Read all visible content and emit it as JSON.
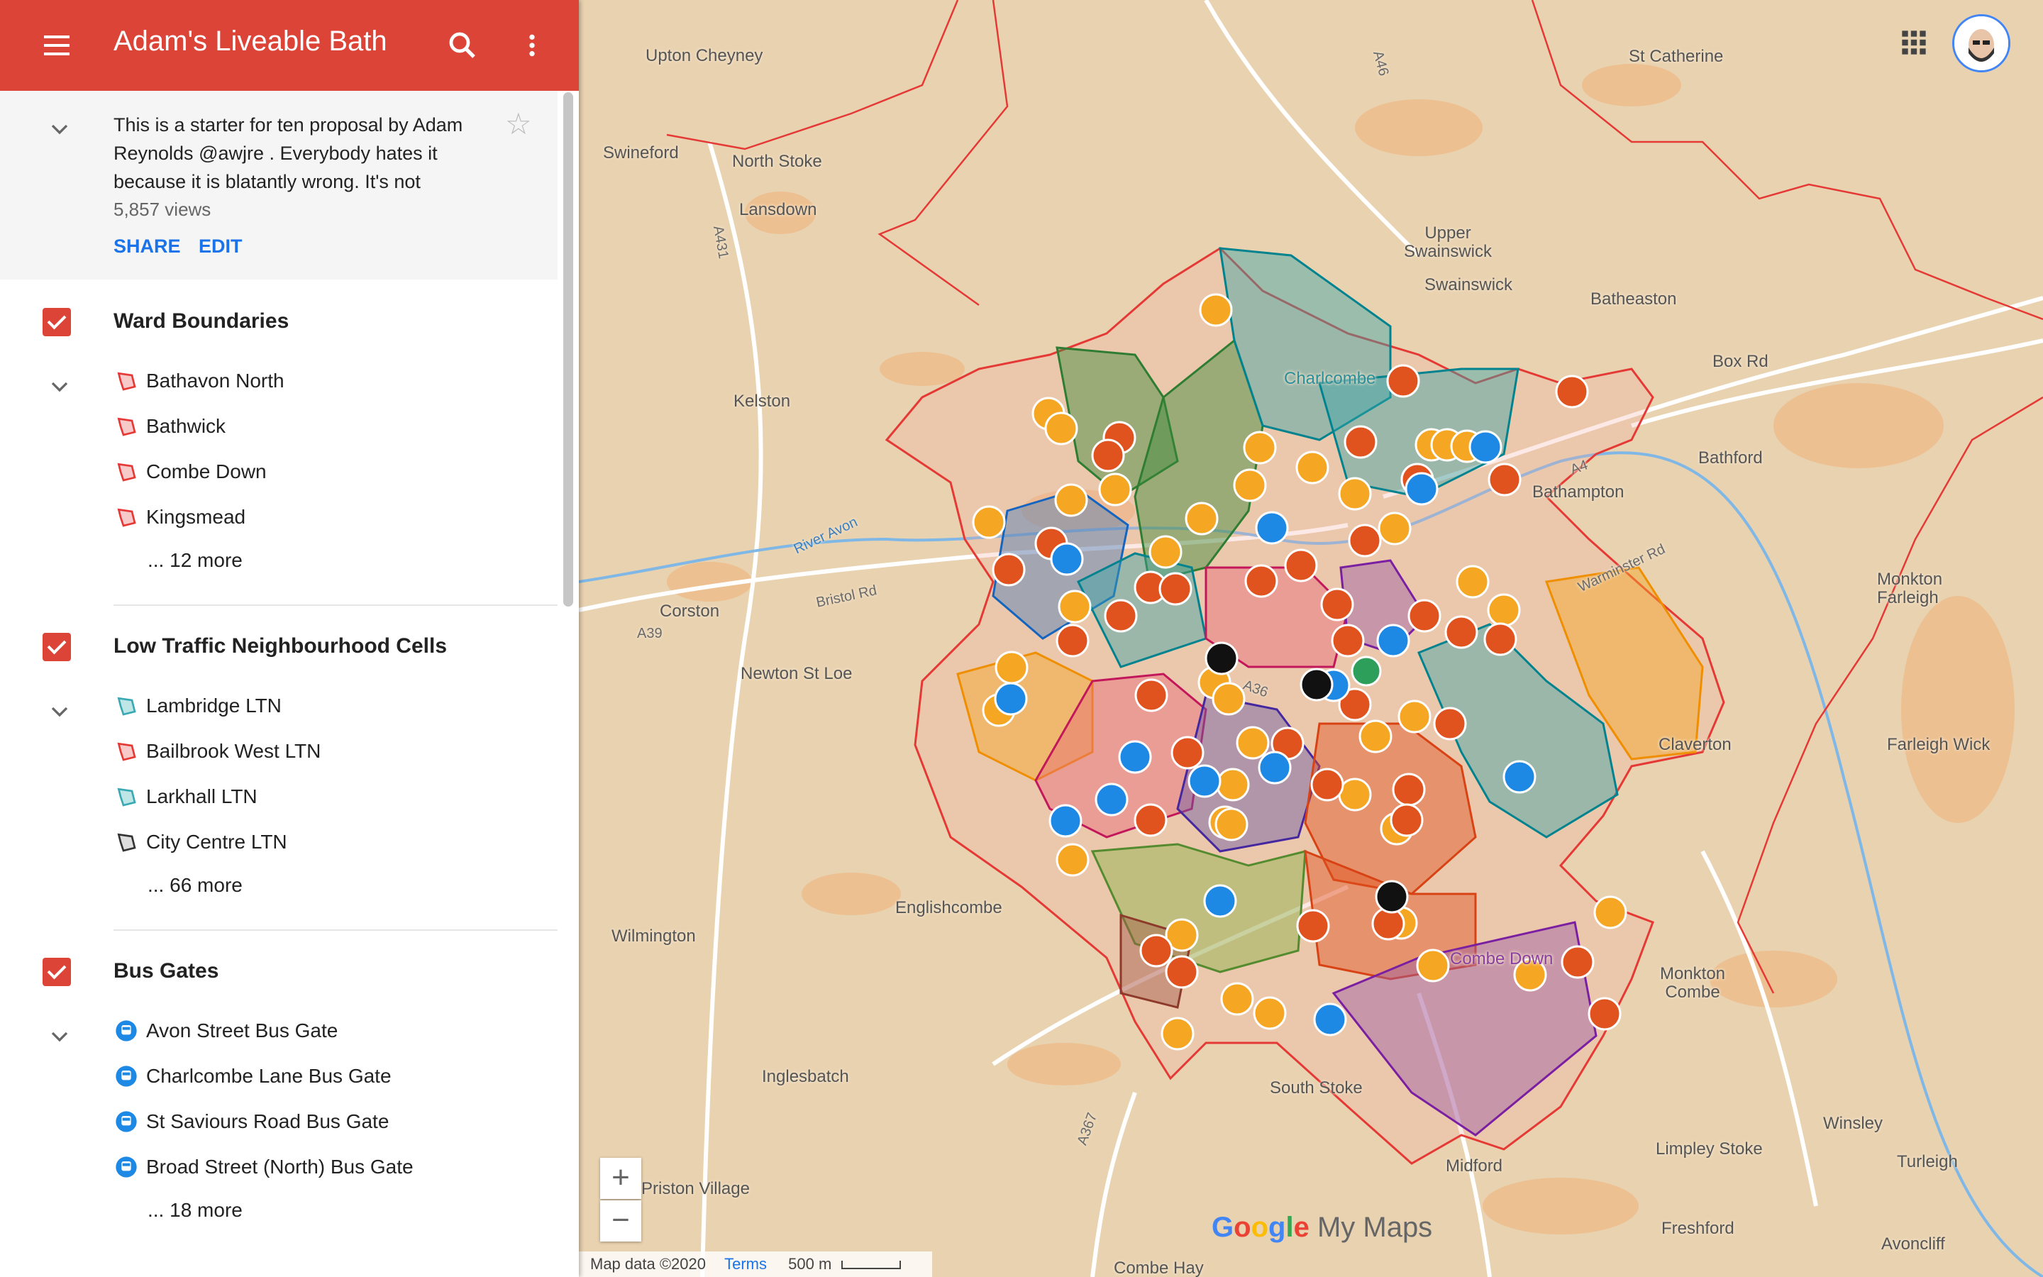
{
  "app": {
    "title": "Adam's Liveable Bath",
    "description": "This is a starter for ten proposal by Adam Reynolds @awjre . Everybody hates it because it is blatantly wrong. It's not",
    "views": "5,857 views",
    "share_label": "SHARE",
    "edit_label": "EDIT"
  },
  "layers": [
    {
      "title": "Ward Boundaries",
      "items": [
        "Bathavon North",
        "Bathwick",
        "Combe Down",
        "Kingsmead"
      ],
      "more": "... 12 more"
    },
    {
      "title": "Low Traffic Neighbourhood Cells",
      "items": [
        "Lambridge LTN",
        "Bailbrook West LTN",
        "Larkhall LTN",
        "City Centre LTN"
      ],
      "more": "... 66 more"
    },
    {
      "title": "Bus Gates",
      "items": [
        "Avon Street Bus Gate",
        "Charlcombe Lane Bus Gate",
        "St Saviours Road Bus Gate",
        "Broad Street (North) Bus Gate"
      ],
      "more": "... 18 more"
    }
  ],
  "map": {
    "places": [
      {
        "name": "Upton Cheyney",
        "line2": ""
      },
      {
        "name": "St Catherine"
      },
      {
        "name": "Swineford"
      },
      {
        "name": "North Stoke"
      },
      {
        "name": "Lansdown"
      },
      {
        "name": "Upper Swainswick"
      },
      {
        "name": "Swainswick"
      },
      {
        "name": "Batheaston"
      },
      {
        "name": "Charlcombe"
      },
      {
        "name": "Box Rd"
      },
      {
        "name": "Kelston"
      },
      {
        "name": "Bathford"
      },
      {
        "name": "Bathampton"
      },
      {
        "name": "Corston"
      },
      {
        "name": "Bristol Rd"
      },
      {
        "name": "Newton St Loe"
      },
      {
        "name": "Monkton Farleigh"
      },
      {
        "name": "Claverton"
      },
      {
        "name": "Farleigh Wick"
      },
      {
        "name": "Englishcombe"
      },
      {
        "name": "Wilmington"
      },
      {
        "name": "Combe Down"
      },
      {
        "name": "Monkton Combe"
      },
      {
        "name": "Inglesbatch"
      },
      {
        "name": "South Stoke"
      },
      {
        "name": "Winsley"
      },
      {
        "name": "Midford"
      },
      {
        "name": "Limpley Stoke"
      },
      {
        "name": "Priston Village"
      },
      {
        "name": "Freshford"
      },
      {
        "name": "Turleigh"
      },
      {
        "name": "Avoncliff"
      },
      {
        "name": "Combe Hay"
      },
      {
        "name": "A39"
      },
      {
        "name": "A46"
      },
      {
        "name": "A4"
      },
      {
        "name": "A431"
      },
      {
        "name": "A36"
      },
      {
        "name": "A367"
      },
      {
        "name": "River Avon"
      },
      {
        "name": "Warminster Rd"
      },
      {
        "name": "Upton Cheyney",
        "hidden": true
      }
    ],
    "attribution": "Map data ©2020",
    "terms": "Terms",
    "scale": "500 m",
    "brand_text": "My Maps",
    "zoom_in": "+",
    "zoom_out": "−",
    "colors": {
      "ward_boundary": "#e53935",
      "school_marker": "#f5a623",
      "barrier_marker": "#e0531f",
      "bus_gate_marker": "#1e88e5",
      "header": "#db4437"
    }
  }
}
